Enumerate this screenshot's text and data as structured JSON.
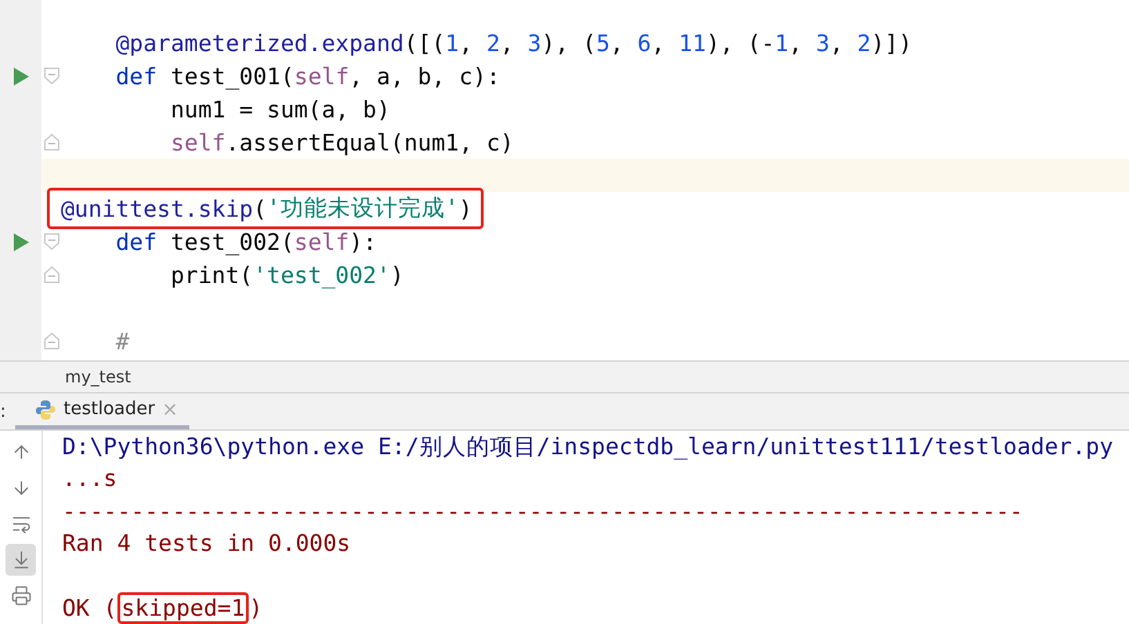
{
  "editor": {
    "lines": [
      {
        "run": false,
        "fold_start": false,
        "fold_end": false,
        "current": false,
        "boxed": false,
        "tokens": [
          {
            "kind": "decorator",
            "text": "    @parameterized.expand"
          },
          {
            "kind": "plain",
            "text": "([("
          },
          {
            "kind": "number",
            "text": "1"
          },
          {
            "kind": "plain",
            "text": ", "
          },
          {
            "kind": "number",
            "text": "2"
          },
          {
            "kind": "plain",
            "text": ", "
          },
          {
            "kind": "number",
            "text": "3"
          },
          {
            "kind": "plain",
            "text": "), ("
          },
          {
            "kind": "number",
            "text": "5"
          },
          {
            "kind": "plain",
            "text": ", "
          },
          {
            "kind": "number",
            "text": "6"
          },
          {
            "kind": "plain",
            "text": ", "
          },
          {
            "kind": "number",
            "text": "11"
          },
          {
            "kind": "plain",
            "text": "), (-"
          },
          {
            "kind": "number",
            "text": "1"
          },
          {
            "kind": "plain",
            "text": ", "
          },
          {
            "kind": "number",
            "text": "3"
          },
          {
            "kind": "plain",
            "text": ", "
          },
          {
            "kind": "number",
            "text": "2"
          },
          {
            "kind": "plain",
            "text": ")])"
          }
        ]
      },
      {
        "run": true,
        "fold_start": true,
        "fold_end": false,
        "current": false,
        "boxed": false,
        "tokens": [
          {
            "kind": "keyword",
            "text": "    def"
          },
          {
            "kind": "plain",
            "text": " test_001("
          },
          {
            "kind": "self",
            "text": "self"
          },
          {
            "kind": "plain",
            "text": ", a, b, c):"
          }
        ]
      },
      {
        "run": false,
        "fold_start": false,
        "fold_end": false,
        "current": false,
        "boxed": false,
        "tokens": [
          {
            "kind": "plain",
            "text": "        num1 = sum(a, b)"
          }
        ]
      },
      {
        "run": false,
        "fold_start": false,
        "fold_end": true,
        "current": false,
        "boxed": false,
        "tokens": [
          {
            "kind": "self",
            "text": "        self"
          },
          {
            "kind": "plain",
            "text": ".assertEqual(num1, c)"
          }
        ]
      },
      {
        "run": false,
        "fold_start": false,
        "fold_end": false,
        "current": true,
        "boxed": false
      },
      {
        "run": false,
        "fold_start": false,
        "fold_end": false,
        "current": false,
        "boxed": true,
        "tokens": [
          {
            "kind": "decorator",
            "text": "@unittest.skip"
          },
          {
            "kind": "plain",
            "text": "("
          },
          {
            "kind": "string",
            "text": "'功能未设计完成'"
          },
          {
            "kind": "plain",
            "text": ")"
          }
        ]
      },
      {
        "run": true,
        "fold_start": true,
        "fold_end": false,
        "current": false,
        "boxed": false,
        "tokens": [
          {
            "kind": "keyword",
            "text": "    def"
          },
          {
            "kind": "plain",
            "text": " test_002("
          },
          {
            "kind": "self",
            "text": "self"
          },
          {
            "kind": "plain",
            "text": "):"
          }
        ]
      },
      {
        "run": false,
        "fold_start": false,
        "fold_end": true,
        "current": false,
        "boxed": false,
        "tokens": [
          {
            "kind": "plain",
            "text": "        print("
          },
          {
            "kind": "string",
            "text": "'test_002'"
          },
          {
            "kind": "plain",
            "text": ")"
          }
        ]
      },
      {
        "run": false,
        "fold_start": false,
        "fold_end": false,
        "current": false,
        "boxed": false
      },
      {
        "run": false,
        "fold_start": false,
        "fold_end": true,
        "current": false,
        "boxed": false,
        "tokens": [
          {
            "kind": "comment",
            "text": "    #"
          }
        ]
      }
    ]
  },
  "breadcrumb": "my_test",
  "run_panel": {
    "label_cut": ":",
    "tabs": [
      {
        "label": "testloader",
        "close": "×",
        "selected": true
      }
    ],
    "toolbar": [
      {
        "kind": "up",
        "on": false
      },
      {
        "kind": "down",
        "on": false
      },
      {
        "kind": "wrap",
        "on": false
      },
      {
        "kind": "scroll-end",
        "on": true
      },
      {
        "kind": "print",
        "on": false
      }
    ],
    "console": [
      {
        "kind": "command",
        "segments": [
          {
            "text": "D:\\Python36\\python.exe E:/别人的项目/inspectdb_learn/unittest111/testloader.py",
            "boxed": false
          }
        ]
      },
      {
        "kind": "output",
        "segments": [
          {
            "text": "...s",
            "boxed": false
          }
        ]
      },
      {
        "kind": "output",
        "segments": [
          {
            "text": "----------------------------------------------------------------------",
            "boxed": false
          }
        ]
      },
      {
        "kind": "output",
        "segments": [
          {
            "text": "Ran 4 tests in 0.000s",
            "boxed": false
          }
        ]
      },
      {
        "kind": "output"
      },
      {
        "kind": "output",
        "segments": [
          {
            "text": "OK (",
            "boxed": false
          },
          {
            "text": "skipped=1",
            "boxed": true
          },
          {
            "text": ")",
            "boxed": false
          }
        ]
      }
    ]
  }
}
